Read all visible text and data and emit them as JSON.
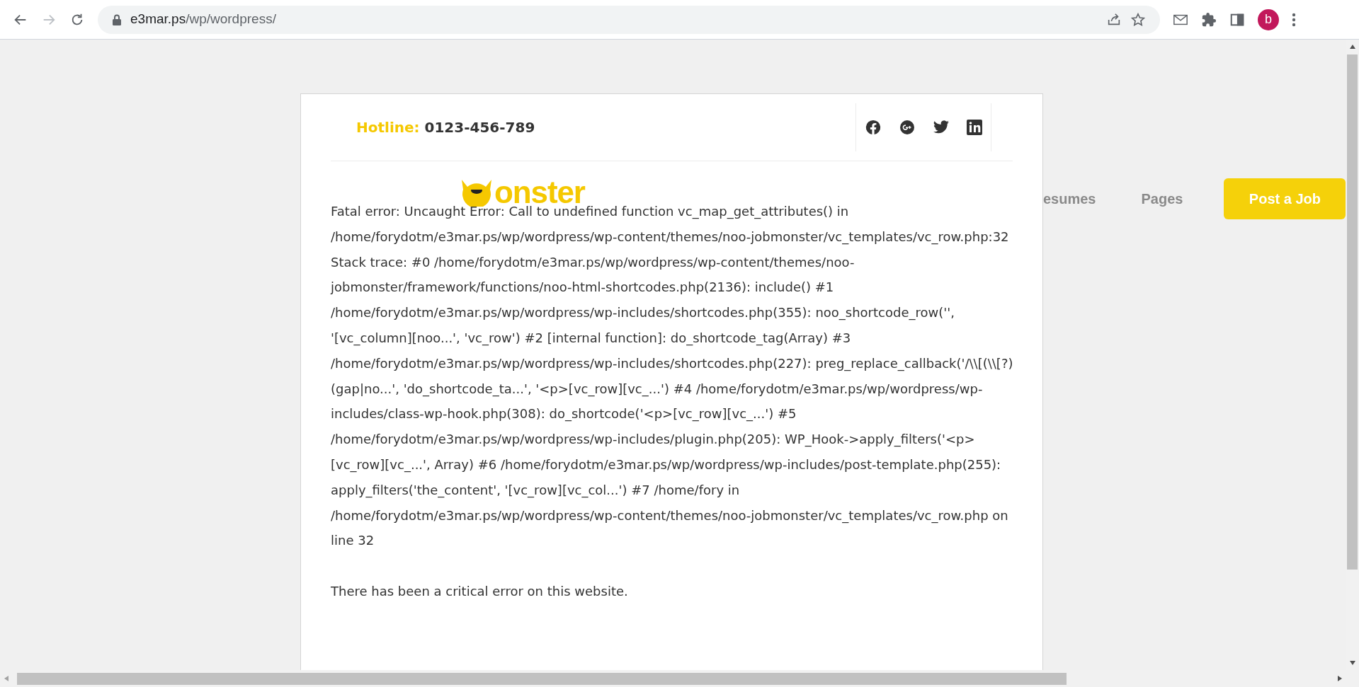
{
  "browser": {
    "url_domain": "e3mar.ps",
    "url_path": "/wp/wordpress/",
    "profile_initial": "b"
  },
  "header": {
    "hotline_label": "Hotline:",
    "hotline_number": "0123-456-789"
  },
  "logo": {
    "text": "onster"
  },
  "nav": {
    "items": [
      "esumes",
      "Pages"
    ],
    "cta": "Post a Job"
  },
  "error": {
    "message": "Fatal error: Uncaught Error: Call to undefined function vc_map_get_attributes() in /home/forydotm/e3mar.ps/wp/wordpress/wp-content/themes/noo-jobmonster/vc_templates/vc_row.php:32 Stack trace: #0 /home/forydotm/e3mar.ps/wp/wordpress/wp-content/themes/noo-jobmonster/framework/functions/noo-html-shortcodes.php(2136): include() #1 /home/forydotm/e3mar.ps/wp/wordpress/wp-includes/shortcodes.php(355): noo_shortcode_row('', '[vc_column][noo...', 'vc_row') #2 [internal function]: do_shortcode_tag(Array) #3 /home/forydotm/e3mar.ps/wp/wordpress/wp-includes/shortcodes.php(227): preg_replace_callback('/\\\\[(\\\\[?)(gap|no...', 'do_shortcode_ta...', '<p>[vc_row][vc_...') #4 /home/forydotm/e3mar.ps/wp/wordpress/wp-includes/class-wp-hook.php(308): do_shortcode('<p>[vc_row][vc_...') #5 /home/forydotm/e3mar.ps/wp/wordpress/wp-includes/plugin.php(205): WP_Hook->apply_filters('<p>[vc_row][vc_...', Array) #6 /home/forydotm/e3mar.ps/wp/wordpress/wp-includes/post-template.php(255): apply_filters('the_content', '[vc_row][vc_col...') #7 /home/fory in /home/forydotm/e3mar.ps/wp/wordpress/wp-content/themes/noo-jobmonster/vc_templates/vc_row.php on line 32",
    "footer_note": "There has been a critical error on this website."
  }
}
